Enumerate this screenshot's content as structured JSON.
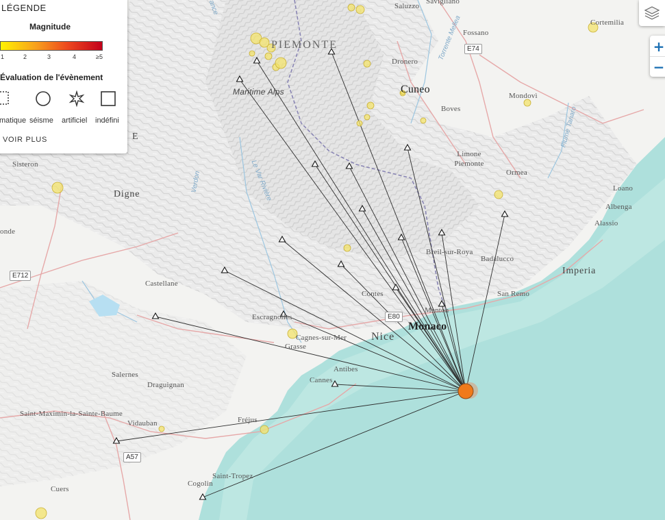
{
  "legend": {
    "title": "LÉGENDE",
    "magnitude_title": "Magnitude",
    "ticks": [
      "1",
      "2",
      "3",
      "4",
      "≥5"
    ],
    "evaluation_title": "Évaluation de l'évènement",
    "evaluation_labels": [
      "matique",
      "séisme",
      "artificiel",
      "indéfini"
    ],
    "more_label": "VOIR PLUS"
  },
  "controls": {
    "zoom_in": "+",
    "zoom_out": "−",
    "layers_icon": "layers-icon"
  },
  "places": {
    "saluzzo": "Saluzzo",
    "savigliano": "Savigliano",
    "fossano": "Fossano",
    "cortemilia": "Cortemilia",
    "piemonte": "PIEMONTE",
    "dronero": "Dronero",
    "cuneo": "Cuneo",
    "maritime_alps": "Maritime Alps",
    "boves": "Boves",
    "mondovi": "Mondovì",
    "limone": "Limone Piemonte",
    "ormea": "Ormea",
    "loano": "Loano",
    "albenga": "Albenga",
    "alassio": "Alassio",
    "sisteron": "Sisteron",
    "digne": "Digne",
    "onde": "onde",
    "breil": "Breil-sur-Roya",
    "badalucco": "Badalucco",
    "imperia": "Imperia",
    "castellane": "Castellane",
    "contes": "Contes",
    "sanremo": "San Remo",
    "menton": "Menton",
    "escragnolles": "Escragnolles",
    "cagnes": "Cagnes-sur-Mer",
    "grasse": "Grasse",
    "nice": "Nice",
    "monaco": "Monaco",
    "antibes": "Antibes",
    "cannes": "Cannes",
    "salernes": "Salernes",
    "draguignan": "Draguignan",
    "saint_maximin": "Saint-Maximin-la-Sainte-Baume",
    "vidauban": "Vidauban",
    "frejus": "Fréjus",
    "saint_tropez": "Saint-Tropez",
    "cogolin": "Cogolin",
    "cuers": "Cuers",
    "e_letter": "E"
  },
  "rivers": {
    "mellea": "Torrente Mellea",
    "tanaro": "Fiume Tanaro",
    "verdon": "Verdon",
    "var": "Le Var Rivière",
    "durance": "Durance"
  },
  "roads": {
    "e74": "E74",
    "e712": "E712",
    "e80": "E80",
    "a57": "A57"
  },
  "map_colors": {
    "sea": "#aee0dc",
    "land_relief": "#e9e9e9",
    "coast_strip": "#cfe8e5",
    "epicenter": "#f07a1b",
    "station_line": "#2b2b2b",
    "road_red": "#e8a0a0",
    "border_purple": "#8a86b4",
    "yellow_event": "#f3e36b"
  },
  "epicenter": {
    "label": "epicenter-marker"
  },
  "stations": {
    "count_label": "stations"
  }
}
